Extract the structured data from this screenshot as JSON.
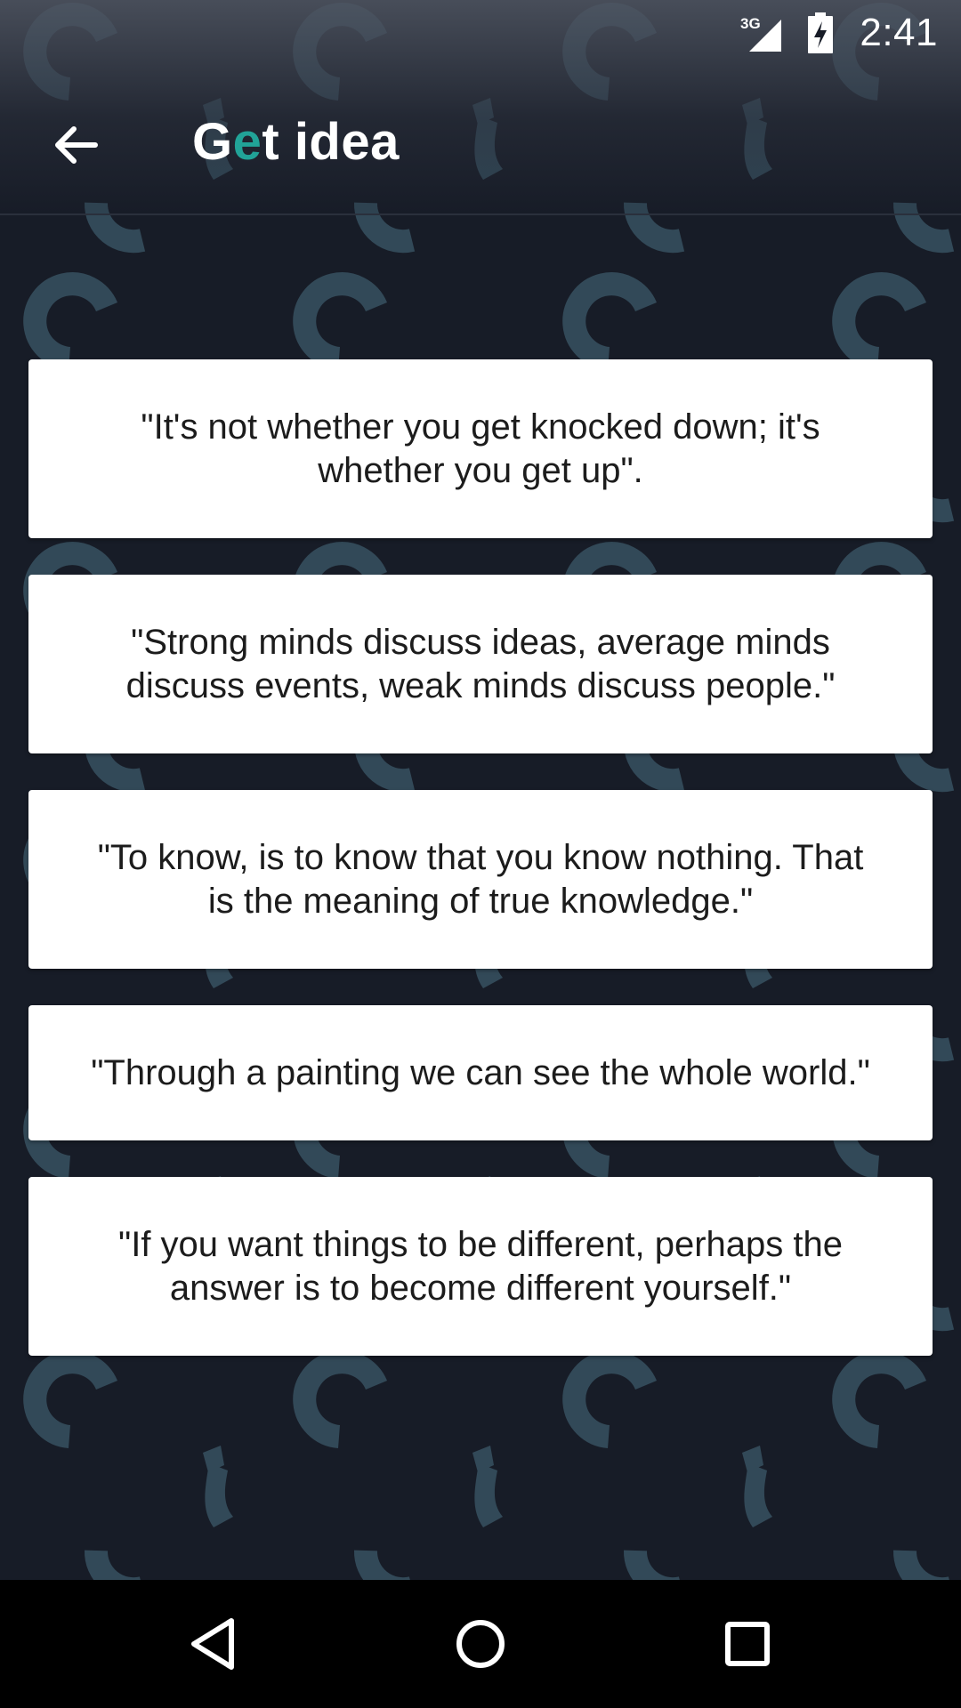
{
  "status_bar": {
    "time": "2:41",
    "network": "3G"
  },
  "app_bar": {
    "title_prefix": "G",
    "title_accent": "e",
    "title_suffix": "t idea",
    "accent_color": "#21a398",
    "back_icon": "arrow-left-icon"
  },
  "quotes": [
    "\"It's not whether you get knocked down; it's whether you get up\".",
    "\"Strong minds discuss ideas, average minds discuss events, weak minds discuss people.\"",
    "\"To know, is to know that you know nothing. That is the meaning of true knowledge.\"",
    "\"Through a painting we can see the whole world.\"",
    "\"If you want things to be different, perhaps the answer is to become different yourself.\""
  ],
  "nav_bar": {
    "back_icon": "triangle-back-icon",
    "home_icon": "circle-home-icon",
    "recent_icon": "square-recents-icon"
  }
}
